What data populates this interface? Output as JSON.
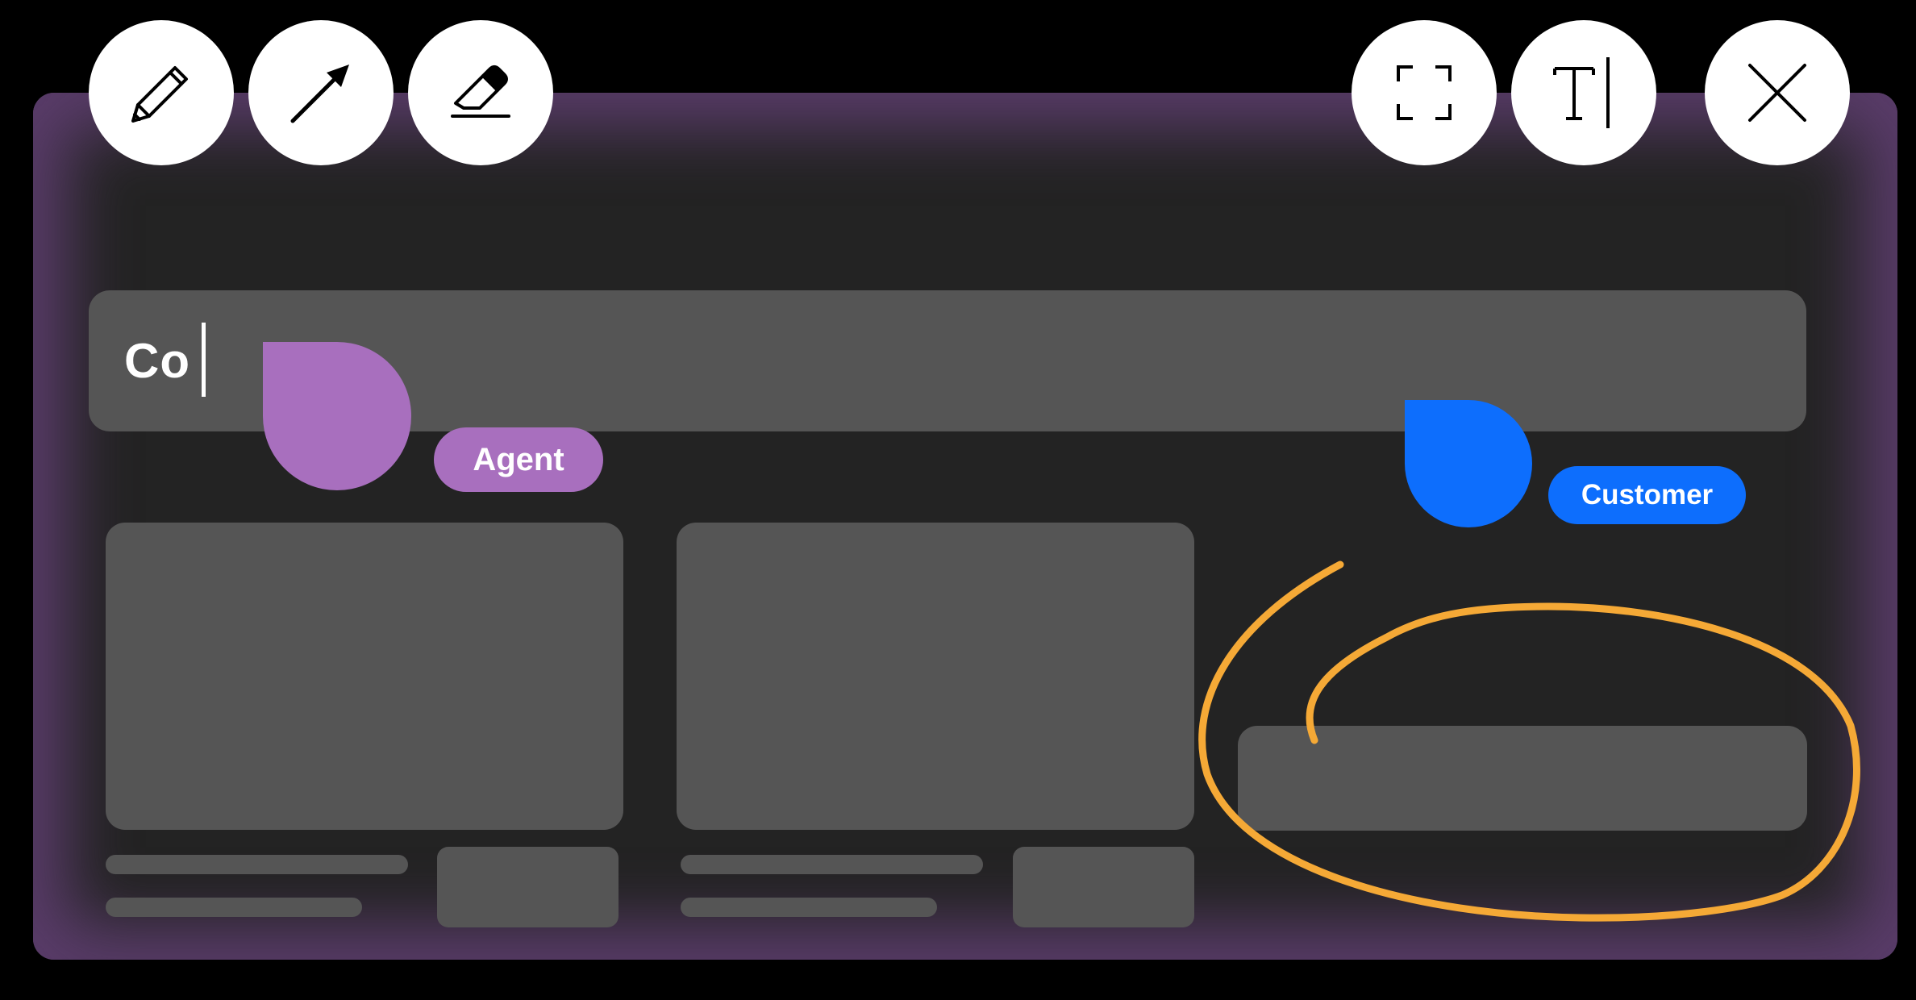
{
  "toolbar": {
    "left_tools": [
      {
        "name": "pencil-icon",
        "label": "Pencil"
      },
      {
        "name": "arrow-icon",
        "label": "Arrow"
      },
      {
        "name": "eraser-icon",
        "label": "Eraser"
      }
    ],
    "right_tools": [
      {
        "name": "screenshot-frame-icon",
        "label": "Frame"
      },
      {
        "name": "text-tool-icon",
        "label": "Text"
      },
      {
        "name": "close-icon",
        "label": "Close"
      }
    ]
  },
  "search": {
    "typed_value": "Co"
  },
  "cursors": {
    "agent": {
      "label": "Agent",
      "color": "#a86fbe"
    },
    "customer": {
      "label": "Customer",
      "color": "#0d6efd"
    }
  },
  "annotation": {
    "stroke_color": "#f5a936"
  },
  "colors": {
    "background": "#000000",
    "frame_glow": "#a86fbe",
    "screen": "#232323",
    "placeholder": "#555555",
    "button": "#ffffff"
  }
}
